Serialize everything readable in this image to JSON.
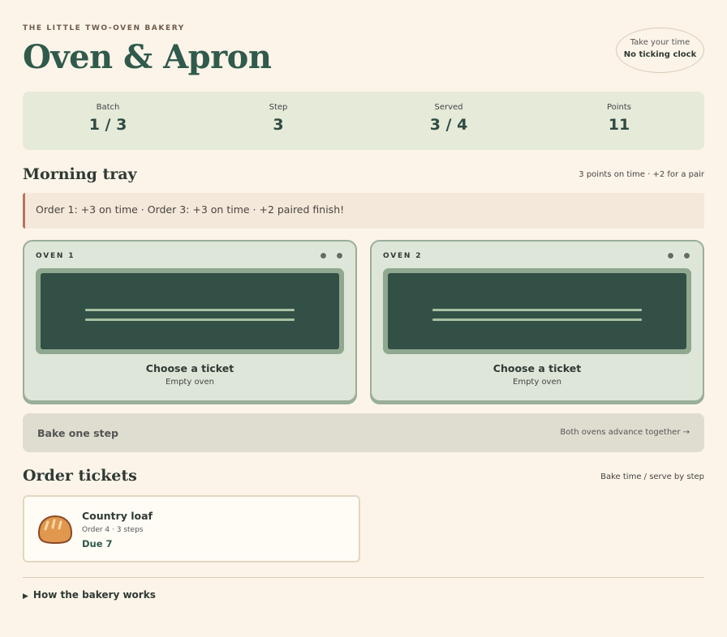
{
  "header": {
    "eyebrow": "THE LITTLE TWO-OVEN BAKERY",
    "title": "Oven & Apron",
    "badge_line1": "Take your time",
    "badge_line2": "No ticking clock"
  },
  "stats": [
    {
      "label": "Batch",
      "value": "1 / 3"
    },
    {
      "label": "Step",
      "value": "3"
    },
    {
      "label": "Served",
      "value": "3 / 4"
    },
    {
      "label": "Points",
      "value": "11"
    }
  ],
  "tray": {
    "title": "Morning tray",
    "note": "3 points on time · +2 for a pair",
    "alert": "Order 1: +3 on time · Order 3: +3 on time · +2 paired finish!"
  },
  "ovens": [
    {
      "label": "OVEN 1",
      "status": "Choose a ticket",
      "sub": "Empty oven"
    },
    {
      "label": "OVEN 2",
      "status": "Choose a ticket",
      "sub": "Empty oven"
    }
  ],
  "bake": {
    "label": "Bake one step",
    "hint": "Both ovens advance together →"
  },
  "tickets": {
    "title": "Order tickets",
    "note": "Bake time / serve by step",
    "items": [
      {
        "name": "Country loaf",
        "meta": "Order 4 · 3 steps",
        "due": "Due 7",
        "icon": "bread-loaf-icon"
      }
    ]
  },
  "details": {
    "label": "How the bakery works"
  },
  "colors": {
    "background": "#fcf4e8",
    "accent": "#2f5a4c",
    "oven_panel": "#dde6d8",
    "oven_window": "#335047",
    "alert_border": "#b8735e"
  }
}
